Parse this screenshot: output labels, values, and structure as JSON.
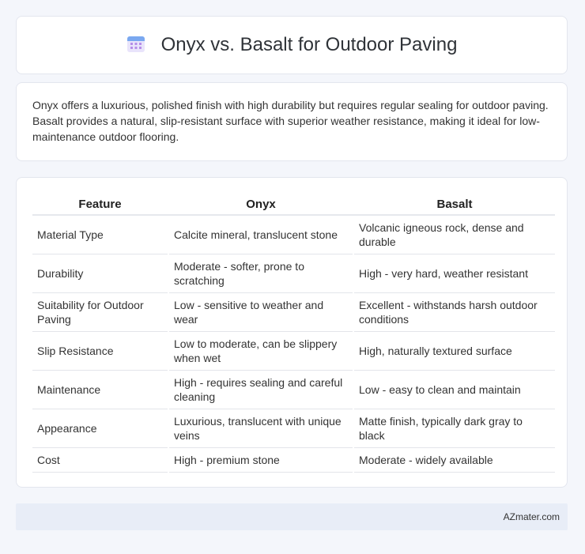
{
  "header": {
    "title": "Onyx vs. Basalt for Outdoor Paving",
    "icon": "calendar-grid-icon"
  },
  "summary": {
    "text": "Onyx offers a luxurious, polished finish with high durability but requires regular sealing for outdoor paving. Basalt provides a natural, slip-resistant surface with superior weather resistance, making it ideal for low-maintenance outdoor flooring."
  },
  "table": {
    "headers": [
      "Feature",
      "Onyx",
      "Basalt"
    ],
    "rows": [
      [
        "Material Type",
        "Calcite mineral, translucent stone",
        "Volcanic igneous rock, dense and durable"
      ],
      [
        "Durability",
        "Moderate - softer, prone to scratching",
        "High - very hard, weather resistant"
      ],
      [
        "Suitability for Outdoor Paving",
        "Low - sensitive to weather and wear",
        "Excellent - withstands harsh outdoor conditions"
      ],
      [
        "Slip Resistance",
        "Low to moderate, can be slippery when wet",
        "High, naturally textured surface"
      ],
      [
        "Maintenance",
        "High - requires sealing and careful cleaning",
        "Low - easy to clean and maintain"
      ],
      [
        "Appearance",
        "Luxurious, translucent with unique veins",
        "Matte finish, typically dark gray to black"
      ],
      [
        "Cost",
        "High - premium stone",
        "Moderate - widely available"
      ]
    ]
  },
  "footer": {
    "brand": "AZmater.com"
  }
}
